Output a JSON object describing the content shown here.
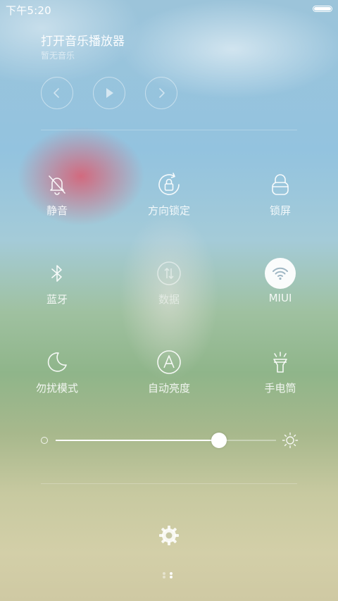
{
  "status_bar": {
    "time": "下午5:20",
    "battery_level": 1.0
  },
  "music_player": {
    "title": "打开音乐播放器",
    "subtitle": "暂无音乐",
    "controls": [
      {
        "icon": "previous-icon"
      },
      {
        "icon": "play-icon"
      },
      {
        "icon": "next-icon"
      }
    ]
  },
  "toggles": [
    {
      "label": "静音",
      "icon": "silent-bell-icon",
      "state": "off"
    },
    {
      "label": "方向锁定",
      "icon": "rotation-lock-icon",
      "state": "off"
    },
    {
      "label": "锁屏",
      "icon": "lock-icon",
      "state": "off"
    },
    {
      "label": "蓝牙",
      "icon": "bluetooth-icon",
      "state": "off"
    },
    {
      "label": "数据",
      "icon": "mobile-data-icon",
      "state": "disabled"
    },
    {
      "label": "MIUI",
      "icon": "wifi-icon",
      "state": "on"
    },
    {
      "label": "勿扰模式",
      "icon": "moon-icon",
      "state": "off"
    },
    {
      "label": "自动亮度",
      "icon": "auto-brightness-icon",
      "state": "off"
    },
    {
      "label": "手电筒",
      "icon": "flashlight-icon",
      "state": "off"
    }
  ],
  "brightness": {
    "level": 0.74,
    "low_icon": "brightness-low-icon",
    "high_icon": "brightness-high-icon"
  },
  "settings": {
    "icon": "gear-icon"
  },
  "pager": {
    "pages": 2,
    "current": 2
  },
  "colors": {
    "accent_active_bg": "#ffffff",
    "active_icon": "#9fb7c4"
  }
}
